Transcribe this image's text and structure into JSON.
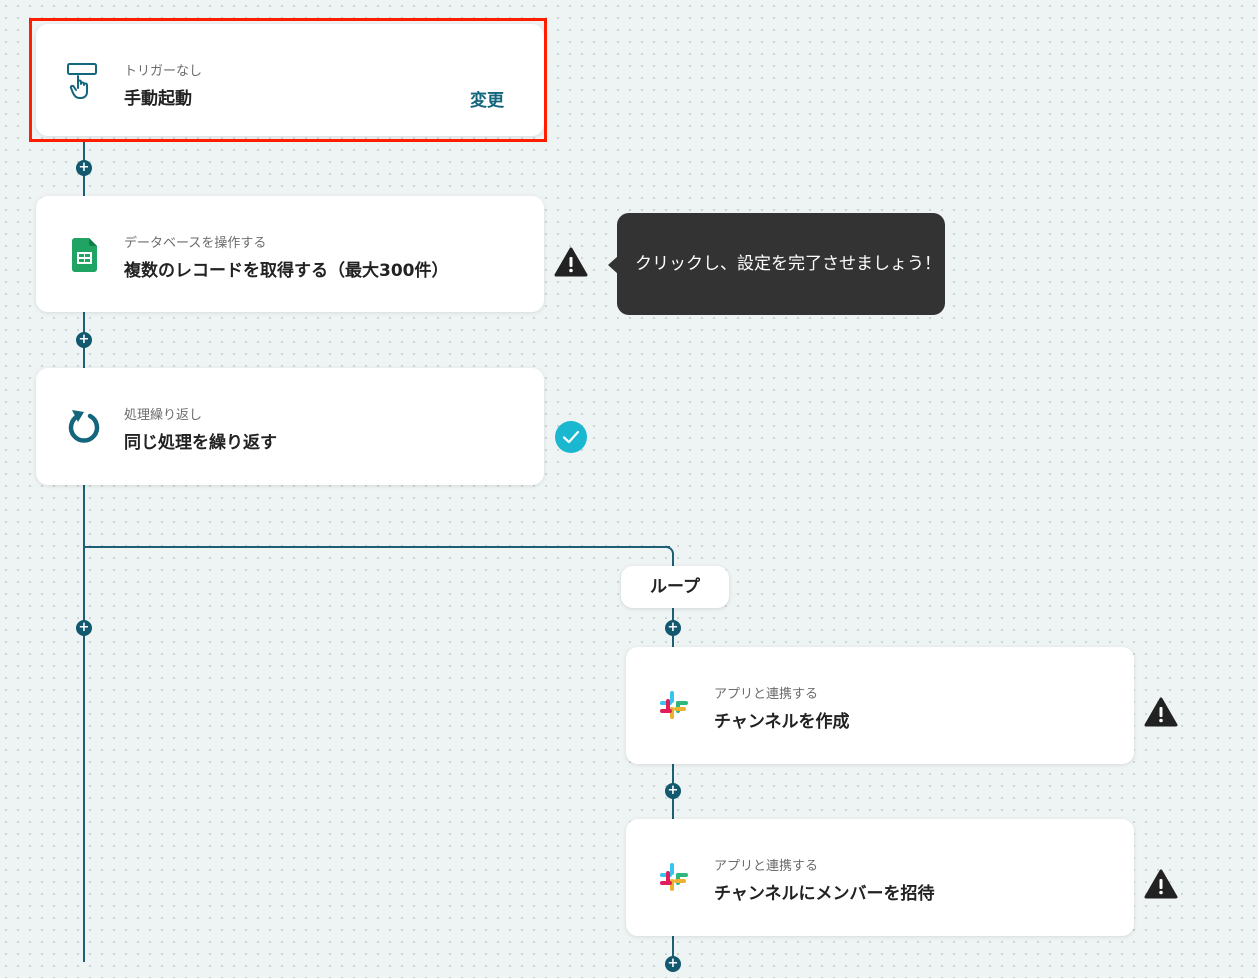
{
  "flow": {
    "trigger": {
      "subtitle": "トリガーなし",
      "title": "手動起動",
      "change_label": "変更",
      "icon": "manual-trigger-icon"
    },
    "steps": [
      {
        "subtitle": "データベースを操作する",
        "title": "複数のレコードを取得する（最大300件）",
        "icon": "google-sheets-icon",
        "status": "warning"
      },
      {
        "subtitle": "処理繰り返し",
        "title": "同じ処理を繰り返す",
        "icon": "repeat-icon",
        "status": "complete"
      }
    ],
    "tooltip": {
      "text": "クリックし、設定を完了させましょう！"
    },
    "loop": {
      "label": "ループ",
      "steps": [
        {
          "subtitle": "アプリと連携する",
          "title": "チャンネルを作成",
          "icon": "slack-icon",
          "status": "warning"
        },
        {
          "subtitle": "アプリと連携する",
          "title": "チャンネルにメンバーを招待",
          "icon": "slack-icon",
          "status": "warning"
        }
      ]
    }
  },
  "colors": {
    "accent": "#14667c",
    "connector": "#1d5f75",
    "highlight": "#ff1f00",
    "warning": "#222222",
    "check": "#19b8d0",
    "tooltip_bg": "#333333"
  }
}
